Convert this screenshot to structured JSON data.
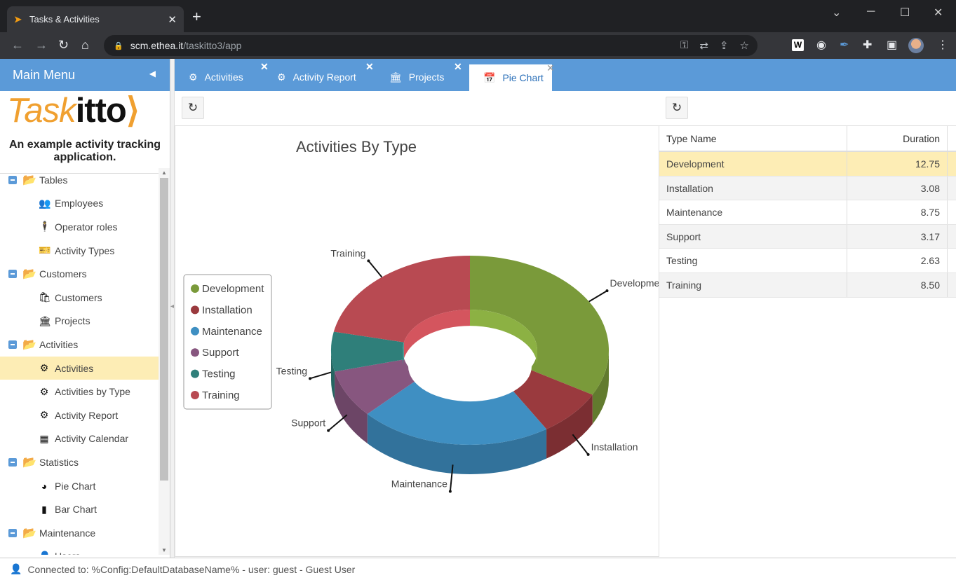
{
  "browser": {
    "tab_title": "Tasks & Activities",
    "url_host": "scm.ethea.it",
    "url_path": "/taskitto3/app",
    "ext_w_label": "W"
  },
  "sidebar": {
    "header": "Main Menu",
    "logo_part1": "Task",
    "logo_part2": "itto",
    "tagline": "An example activity tracking application.",
    "tree": [
      {
        "type": "group",
        "label": "Tables",
        "icon": "folder-icon"
      },
      {
        "type": "leaf",
        "label": "Employees",
        "icon": "people-icon",
        "glyph": "👥"
      },
      {
        "type": "leaf",
        "label": "Operator roles",
        "icon": "person-icon",
        "glyph": "🕴"
      },
      {
        "type": "leaf",
        "label": "Activity Types",
        "icon": "ticket-icon",
        "glyph": "🎫"
      },
      {
        "type": "group",
        "label": "Customers",
        "icon": "folder-icon"
      },
      {
        "type": "leaf",
        "label": "Customers",
        "icon": "basket-icon",
        "glyph": "🛍"
      },
      {
        "type": "leaf",
        "label": "Projects",
        "icon": "bank-icon",
        "glyph": "🏛"
      },
      {
        "type": "group",
        "label": "Activities",
        "icon": "folder-icon"
      },
      {
        "type": "leaf",
        "label": "Activities",
        "icon": "gear-icon",
        "glyph": "⚙",
        "selected": true
      },
      {
        "type": "leaf",
        "label": "Activities by Type",
        "icon": "gear-icon",
        "glyph": "⚙"
      },
      {
        "type": "leaf",
        "label": "Activity Report",
        "icon": "gear-icon",
        "glyph": "⚙"
      },
      {
        "type": "leaf",
        "label": "Activity Calendar",
        "icon": "grid-icon",
        "glyph": "▦"
      },
      {
        "type": "group",
        "label": "Statistics",
        "icon": "folder-icon"
      },
      {
        "type": "leaf",
        "label": "Pie Chart",
        "icon": "pie-chart-icon",
        "glyph": "◕"
      },
      {
        "type": "leaf",
        "label": "Bar Chart",
        "icon": "bar-chart-icon",
        "glyph": "▮"
      },
      {
        "type": "group",
        "label": "Maintenance",
        "icon": "folder-icon"
      },
      {
        "type": "leaf",
        "label": "Users",
        "icon": "user-icon",
        "glyph": "👤"
      }
    ]
  },
  "tabs": [
    {
      "label": "Activities",
      "icon": "gear-icon",
      "glyph": "⚙",
      "active": false
    },
    {
      "label": "Activity Report",
      "icon": "gear-icon",
      "glyph": "⚙",
      "active": false
    },
    {
      "label": "Projects",
      "icon": "bank-icon",
      "glyph": "🏛",
      "active": false
    },
    {
      "label": "Pie Chart",
      "icon": "calendar-icon",
      "glyph": "📅",
      "active": true
    }
  ],
  "grid": {
    "col_name": "Type Name",
    "col_duration": "Duration",
    "rows": [
      {
        "name": "Development",
        "duration": "12.75"
      },
      {
        "name": "Installation",
        "duration": "3.08"
      },
      {
        "name": "Maintenance",
        "duration": "8.75"
      },
      {
        "name": "Support",
        "duration": "3.17"
      },
      {
        "name": "Testing",
        "duration": "2.63"
      },
      {
        "name": "Training",
        "duration": "8.50"
      }
    ]
  },
  "chart_data": {
    "type": "pie",
    "title": "Activities By Type",
    "labels": [
      "Development",
      "Installation",
      "Maintenance",
      "Support",
      "Testing",
      "Training"
    ],
    "values": [
      12.75,
      3.08,
      8.75,
      3.17,
      2.63,
      8.5
    ],
    "colors": [
      "#7a9a3a",
      "#9a3a3e",
      "#3f8fc2",
      "#87567f",
      "#2f7f7a",
      "#b84a52"
    ],
    "donut": true,
    "legend_position": "left"
  },
  "status": {
    "text": "Connected to: %Config:DefaultDatabaseName% - user: guest - Guest User"
  }
}
